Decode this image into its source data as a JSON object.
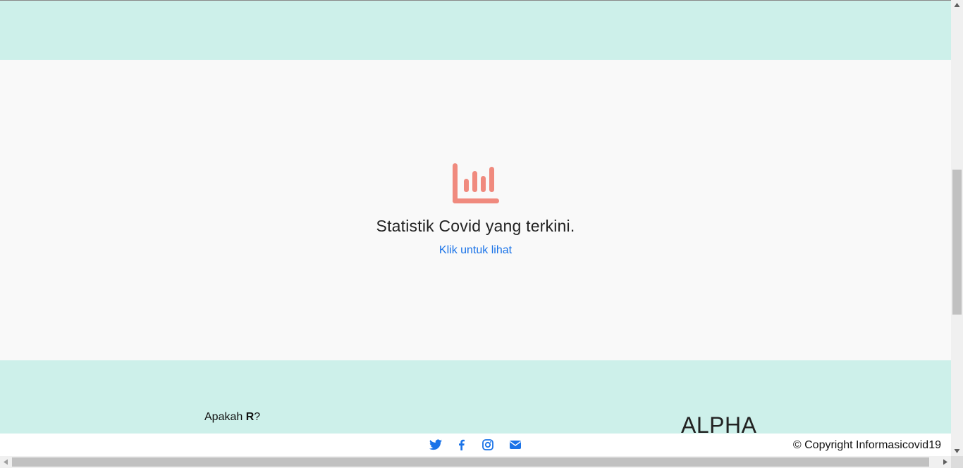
{
  "stats": {
    "title": "Statistik Covid yang terkini.",
    "link_label": "Klik untuk lihat",
    "icon": "chart-bar-icon",
    "icon_color": "#f08a7e"
  },
  "about": {
    "prefix": "Apakah ",
    "bold": "R",
    "suffix": "?"
  },
  "brand": {
    "name": "ALPHA"
  },
  "footer": {
    "social_icons": [
      "twitter-icon",
      "facebook-icon",
      "instagram-icon",
      "envelope-icon"
    ],
    "copyright": "© Copyright Informasicovid19",
    "icon_color": "#1a73e8"
  },
  "colors": {
    "band": "#cdf0ea",
    "main_bg": "#f9f9f9",
    "link": "#1a73e8"
  }
}
